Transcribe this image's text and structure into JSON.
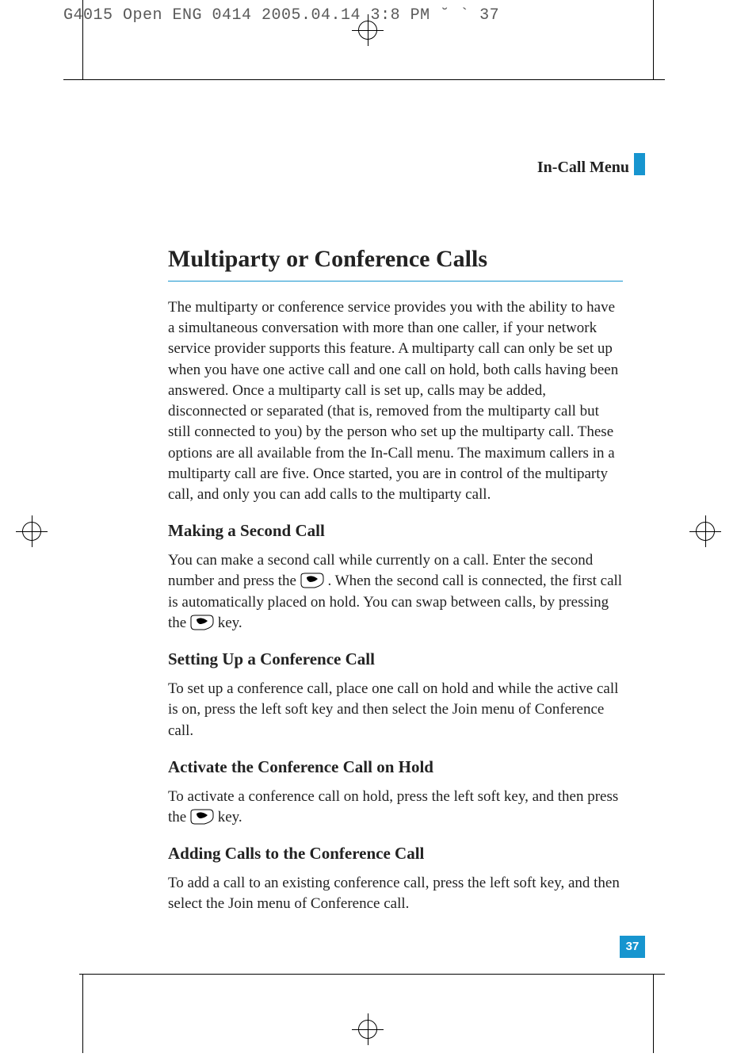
{
  "proof_header": "G4015 Open ENG 0414  2005.04.14 3:8 PM  ˘   ` 37",
  "running_head": "In-Call Menu",
  "title": "Multiparty or Conference Calls",
  "intro": "The multiparty or conference service provides you with the ability to have a simultaneous conversation with more than one caller, if your network service provider supports this feature. A multiparty call can only be set up when you have one active call and one call on hold, both calls having been answered. Once a multiparty call is set up, calls may be added, disconnected or separated (that is, removed from the multiparty call but still connected to you) by the person who set up the multiparty call. These options are all available from the In-Call menu. The maximum callers in a multiparty call are five. Once started, you are in control of the multiparty call, and only you can add calls to the multiparty call.",
  "s1_h": "Making a Second Call",
  "s1_a": "You can make a second call while currently on a call. Enter the second number and press the ",
  "s1_b": " . When the second call is connected, the first call is automatically placed on hold. You can swap between calls, by pressing the ",
  "s1_c": " key.",
  "s2_h": "Setting Up a Conference Call",
  "s2_p": "To set up a conference call, place one call on hold and while the active call is on, press the left soft key and then select the Join menu of Conference call.",
  "s3_h": "Activate the Conference Call on Hold",
  "s3_a": "To activate a conference call on hold, press the left soft key, and then press the ",
  "s3_b": " key.",
  "s4_h": "Adding Calls to the Conference Call",
  "s4_p": "To add a call to an existing conference call, press the left soft key, and then select the Join menu of Conference call.",
  "page_number": "37"
}
